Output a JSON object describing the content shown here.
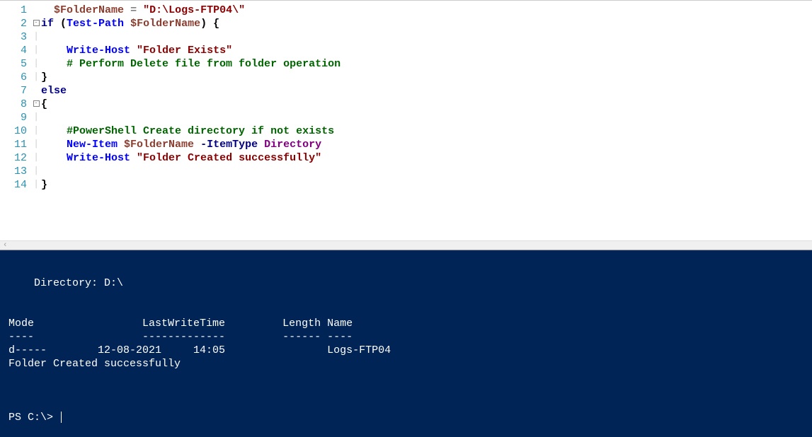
{
  "editor": {
    "lines": [
      {
        "num": "1",
        "fold": "",
        "tokens": [
          [
            "",
            "  "
          ],
          [
            "tok-var",
            "$FolderName"
          ],
          [
            "",
            " "
          ],
          [
            "tok-op",
            "="
          ],
          [
            "",
            " "
          ],
          [
            "tok-str",
            "\"D:\\Logs-FTP04\\\""
          ]
        ]
      },
      {
        "num": "2",
        "fold": "box",
        "tokens": [
          [
            "tok-kw",
            "if"
          ],
          [
            "",
            " "
          ],
          [
            "tok-punct",
            "("
          ],
          [
            "tok-cmd",
            "Test-Path"
          ],
          [
            "",
            " "
          ],
          [
            "tok-var",
            "$FolderName"
          ],
          [
            "tok-punct",
            ")"
          ],
          [
            "",
            " "
          ],
          [
            "tok-punct",
            "{"
          ]
        ]
      },
      {
        "num": "3",
        "fold": "bar",
        "tokens": []
      },
      {
        "num": "4",
        "fold": "bar",
        "tokens": [
          [
            "",
            "    "
          ],
          [
            "tok-cmd",
            "Write-Host"
          ],
          [
            "",
            " "
          ],
          [
            "tok-str",
            "\"Folder Exists\""
          ]
        ]
      },
      {
        "num": "5",
        "fold": "bar",
        "tokens": [
          [
            "",
            "    "
          ],
          [
            "tok-comment",
            "# Perform Delete file from folder operation"
          ]
        ]
      },
      {
        "num": "6",
        "fold": "bar",
        "tokens": [
          [
            "tok-punct",
            "}"
          ]
        ]
      },
      {
        "num": "7",
        "fold": "",
        "tokens": [
          [
            "tok-kw",
            "else"
          ]
        ]
      },
      {
        "num": "8",
        "fold": "box",
        "tokens": [
          [
            "tok-punct",
            "{"
          ]
        ]
      },
      {
        "num": "9",
        "fold": "bar",
        "tokens": []
      },
      {
        "num": "10",
        "fold": "bar",
        "tokens": [
          [
            "",
            "    "
          ],
          [
            "tok-comment",
            "#PowerShell Create directory if not exists"
          ]
        ]
      },
      {
        "num": "11",
        "fold": "bar",
        "tokens": [
          [
            "",
            "    "
          ],
          [
            "tok-cmd",
            "New-Item"
          ],
          [
            "",
            " "
          ],
          [
            "tok-var",
            "$FolderName"
          ],
          [
            "",
            " "
          ],
          [
            "tok-param",
            "-ItemType"
          ],
          [
            "",
            " "
          ],
          [
            "tok-type",
            "Directory"
          ]
        ]
      },
      {
        "num": "12",
        "fold": "bar",
        "tokens": [
          [
            "",
            "    "
          ],
          [
            "tok-cmd",
            "Write-Host"
          ],
          [
            "",
            " "
          ],
          [
            "tok-str",
            "\"Folder Created successfully\""
          ]
        ]
      },
      {
        "num": "13",
        "fold": "bar",
        "tokens": []
      },
      {
        "num": "14",
        "fold": "bar",
        "tokens": [
          [
            "tok-punct",
            "}"
          ]
        ]
      }
    ]
  },
  "terminal": {
    "lines": [
      "",
      "    Directory: D:\\",
      "",
      "",
      "Mode                 LastWriteTime         Length Name",
      "----                 -------------         ------ ----",
      "d-----        12-08-2021     14:05                Logs-FTP04",
      "Folder Created successfully",
      "",
      "",
      ""
    ],
    "prompt": "PS C:\\> "
  }
}
